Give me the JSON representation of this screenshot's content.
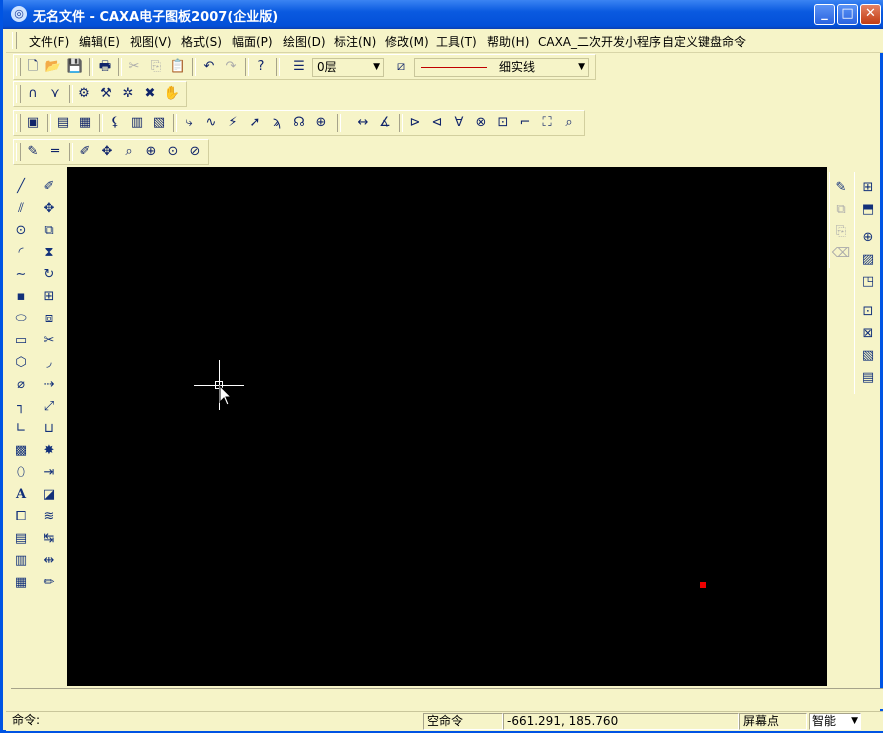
{
  "window": {
    "title": "无名文件 - CAXA电子图板2007(企业版)",
    "minimize": "_",
    "maximize": "□",
    "close": "✕"
  },
  "menu": [
    "文件(F)",
    "编辑(E)",
    "视图(V)",
    "格式(S)",
    "幅面(P)",
    "绘图(D)",
    "标注(N)",
    "修改(M)",
    "工具(T)",
    "帮助(H)",
    "CAXA_二次开发小程序",
    "自定义键盘命令"
  ],
  "layer": {
    "value": "0层"
  },
  "linetype": {
    "value": "细实线"
  },
  "command": {
    "prompt": "命令:"
  },
  "status": {
    "command_state": "空命令",
    "coordinates": "-661.291, 185.760",
    "snap_label": "屏幕点",
    "mode": "智能"
  },
  "colors": {
    "canvas": "#000000",
    "panel": "#f6f4c8",
    "title": "#0a5ae0",
    "marker": "#e00000"
  }
}
